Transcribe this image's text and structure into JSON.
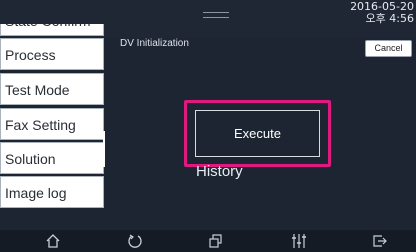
{
  "status": {
    "date": "2016-05-20",
    "time": "오후 4:56"
  },
  "header": {
    "title": "DV Initialization",
    "cancel_label": "Cancel"
  },
  "sidebar": {
    "items": [
      {
        "label": "State Confirm"
      },
      {
        "label": "Process"
      },
      {
        "label": "Test Mode"
      },
      {
        "label": "Fax Setting"
      },
      {
        "label": "Solution"
      },
      {
        "label": "Image log"
      }
    ]
  },
  "main": {
    "execute_label": "Execute",
    "history_label": "History"
  },
  "navbar": {
    "icons": [
      "home-icon",
      "back-icon",
      "copy-icon",
      "settings-sliders-icon",
      "logout-icon"
    ]
  },
  "colors": {
    "background": "#1c2531",
    "highlight": "#e0187f",
    "panel": "#ffffff"
  }
}
